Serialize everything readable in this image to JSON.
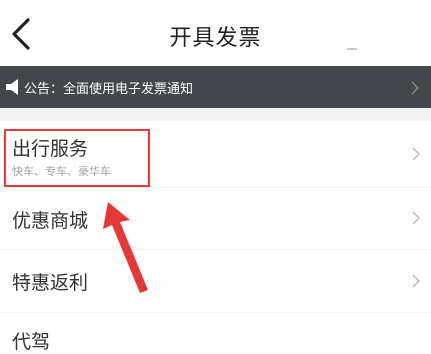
{
  "header": {
    "title": "开具发票",
    "back_icon": "chevron-left-icon"
  },
  "notice": {
    "text": "公告：全面使用电子发票通知",
    "icon": "speaker-icon",
    "background": "#43464b"
  },
  "list": {
    "items": [
      {
        "label": "出行服务",
        "subtitle": "快车、专车、豪华车"
      },
      {
        "label": "优惠商城"
      },
      {
        "label": "特惠返利"
      },
      {
        "label": "代驾"
      }
    ]
  },
  "annotation": {
    "highlight_color": "#e53935",
    "highlight_target": "出行服务"
  }
}
